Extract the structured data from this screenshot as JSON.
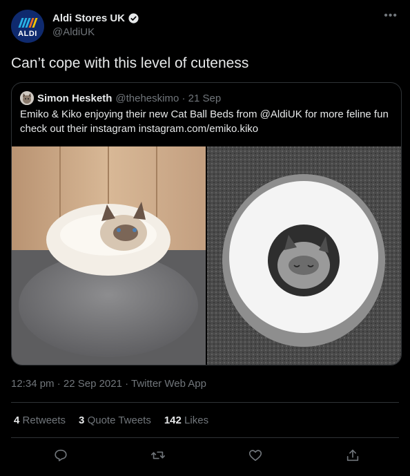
{
  "author": {
    "display_name": "Aldi Stores UK",
    "handle": "@AldiUK",
    "avatar_text": "ALDI"
  },
  "tweet": {
    "text": "Can’t cope with this level of cuteness",
    "timestamp": "12:34 pm · 22 Sep 2021 · Twitter Web App"
  },
  "quoted": {
    "name": "Simon Hesketh",
    "meta": "@theheskimo · 21 Sep",
    "text": "Emiko & Kiko enjoying their new Cat Ball Beds from @AldiUK for more feline fun check out their instagram instagram.com/emiko.kiko"
  },
  "stats": {
    "retweets_count": "4",
    "retweets_label": "Retweets",
    "quotes_count": "3",
    "quotes_label": "Quote Tweets",
    "likes_count": "142",
    "likes_label": "Likes"
  },
  "icons": {
    "more": "more-icon",
    "verified": "verified-icon",
    "reply": "reply-icon",
    "retweet": "retweet-icon",
    "like": "like-icon",
    "share": "share-icon"
  },
  "colors": {
    "background": "#000000",
    "text": "#e7e9ea",
    "muted": "#71767b",
    "border": "#2f3336",
    "verified": "#1d9bf0"
  }
}
